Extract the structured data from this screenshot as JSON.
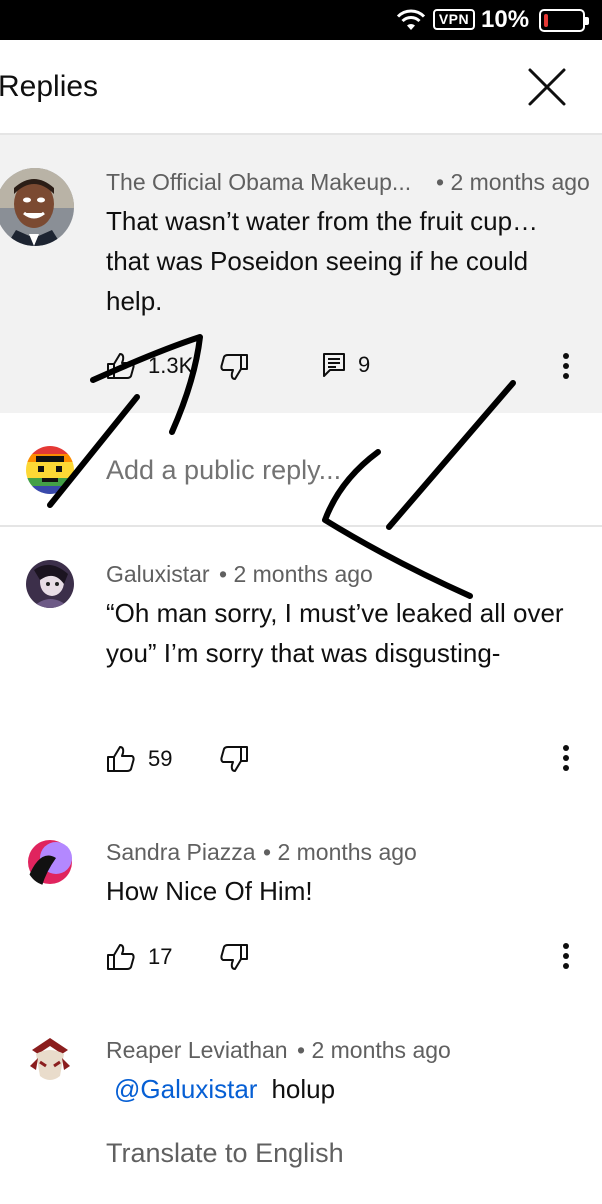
{
  "status_bar": {
    "vpn_label": "VPN",
    "battery_text": "10%",
    "battery_level": 0.1,
    "battery_alert_color": "#e53935"
  },
  "header": {
    "title": "Replies",
    "close_icon": "close-icon"
  },
  "parent_comment": {
    "author": "The Official Obama Makeup...",
    "time": "• 2 months ago",
    "text": "That wasn’t water from the fruit cup… that was Poseidon seeing if he could help.",
    "likes": "1.3K",
    "replies": "9",
    "background": "#f2f2f2"
  },
  "reply_input": {
    "placeholder": "Add a public reply..."
  },
  "replies": [
    {
      "author": "Galuxistar",
      "time": "• 2 months ago",
      "text": "“Oh man sorry, I must’ve leaked all over you” I’m sorry that was disgusting-",
      "likes": "59"
    },
    {
      "author": "Sandra Piazza",
      "time": "• 2 months ago",
      "text": "How Nice Of Him!",
      "likes": "17"
    },
    {
      "author": "Reaper Leviathan",
      "time": "• 2 months ago",
      "mention": "@Galuxistar",
      "text": "holup",
      "translate_label": "Translate to English"
    }
  ],
  "colors": {
    "link": "#065fd4",
    "meta": "#606060",
    "divider": "#e5e5e5"
  }
}
